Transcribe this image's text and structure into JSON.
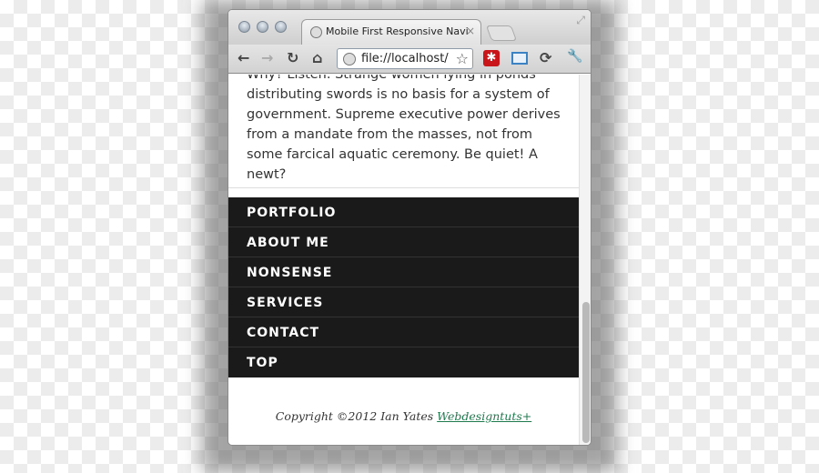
{
  "browser": {
    "tab_title": "Mobile First Responsive Navi",
    "url": "file://localhost/",
    "buttons": {
      "back": "←",
      "forward": "→",
      "reload": "↻",
      "home": "⌂",
      "close_tab": "×",
      "bookmark": "☆",
      "extension": "✱",
      "wrench": "🔧"
    }
  },
  "page": {
    "paragraph": "Why? Listen. Strange women lying in ponds distributing swords is no basis for a system of government. Supreme executive power derives from a mandate from the masses, not from some farcical aquatic ceremony. Be quiet! A newt?",
    "nav": [
      "PORTFOLIO",
      "ABOUT ME",
      "NONSENSE",
      "SERVICES",
      "CONTACT",
      "TOP"
    ],
    "footer_text": "Copyright ©2012 Ian Yates ",
    "footer_link": "Webdesigntuts+"
  },
  "colors": {
    "nav_bg": "#1a1a1a",
    "link": "#1f7a4e"
  },
  "scroll_position_fraction": 0.6
}
